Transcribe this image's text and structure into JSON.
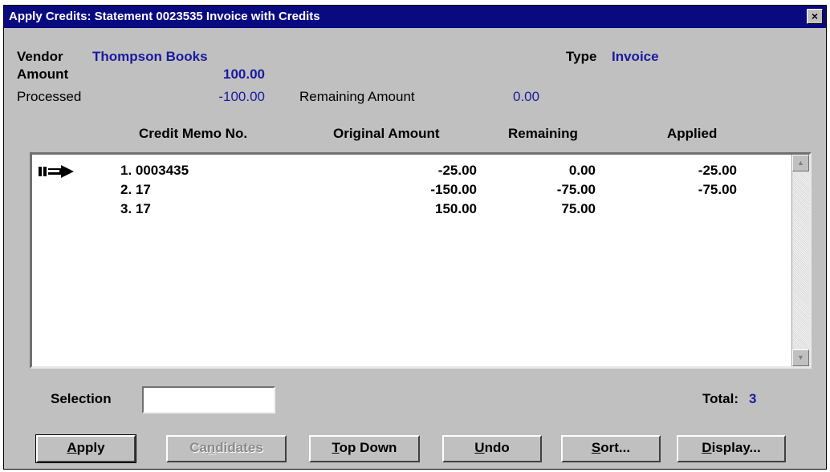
{
  "window": {
    "title": "Apply Credits: Statement 0023535 Invoice with Credits",
    "close_glyph": "×"
  },
  "header": {
    "vendor_label": "Vendor",
    "vendor_value": "Thompson Books",
    "type_label": "Type",
    "type_value": "Invoice",
    "amount_label": "Amount",
    "amount_value": "100.00",
    "processed_label": "Processed",
    "processed_value": "-100.00",
    "remaining_label": "Remaining Amount",
    "remaining_value": "0.00"
  },
  "columns": {
    "credit_memo": "Credit Memo No.",
    "original": "Original Amount",
    "remaining": "Remaining",
    "applied": "Applied"
  },
  "rows": [
    {
      "no": "1. 0003435",
      "original": "-25.00",
      "remaining": "0.00",
      "applied": "-25.00",
      "current": true
    },
    {
      "no": "2. 17",
      "original": "-150.00",
      "remaining": "-75.00",
      "applied": "-75.00",
      "current": false
    },
    {
      "no": "3. 17",
      "original": "150.00",
      "remaining": "75.00",
      "applied": "",
      "current": false
    }
  ],
  "selection": {
    "label": "Selection",
    "value": ""
  },
  "total": {
    "label": "Total:",
    "value": "3"
  },
  "buttons": {
    "apply": {
      "pre": "",
      "u": "A",
      "post": "pply"
    },
    "candidates": {
      "pre": "Ca",
      "u": "n",
      "post": "didates"
    },
    "top_down": {
      "pre": "",
      "u": "T",
      "post": "op Down"
    },
    "undo": {
      "pre": "",
      "u": "U",
      "post": "ndo"
    },
    "sort": {
      "pre": "",
      "u": "S",
      "post": "ort..."
    },
    "display": {
      "pre": "",
      "u": "D",
      "post": "isplay..."
    }
  },
  "icons": {
    "current_row": "arrow-right-icon",
    "scroll_up": "scroll-up-icon",
    "scroll_down": "scroll-down-icon"
  },
  "colors": {
    "titlebar": "#0a0a80",
    "value_text": "#1a1aa0",
    "face": "#c0c0c0"
  }
}
